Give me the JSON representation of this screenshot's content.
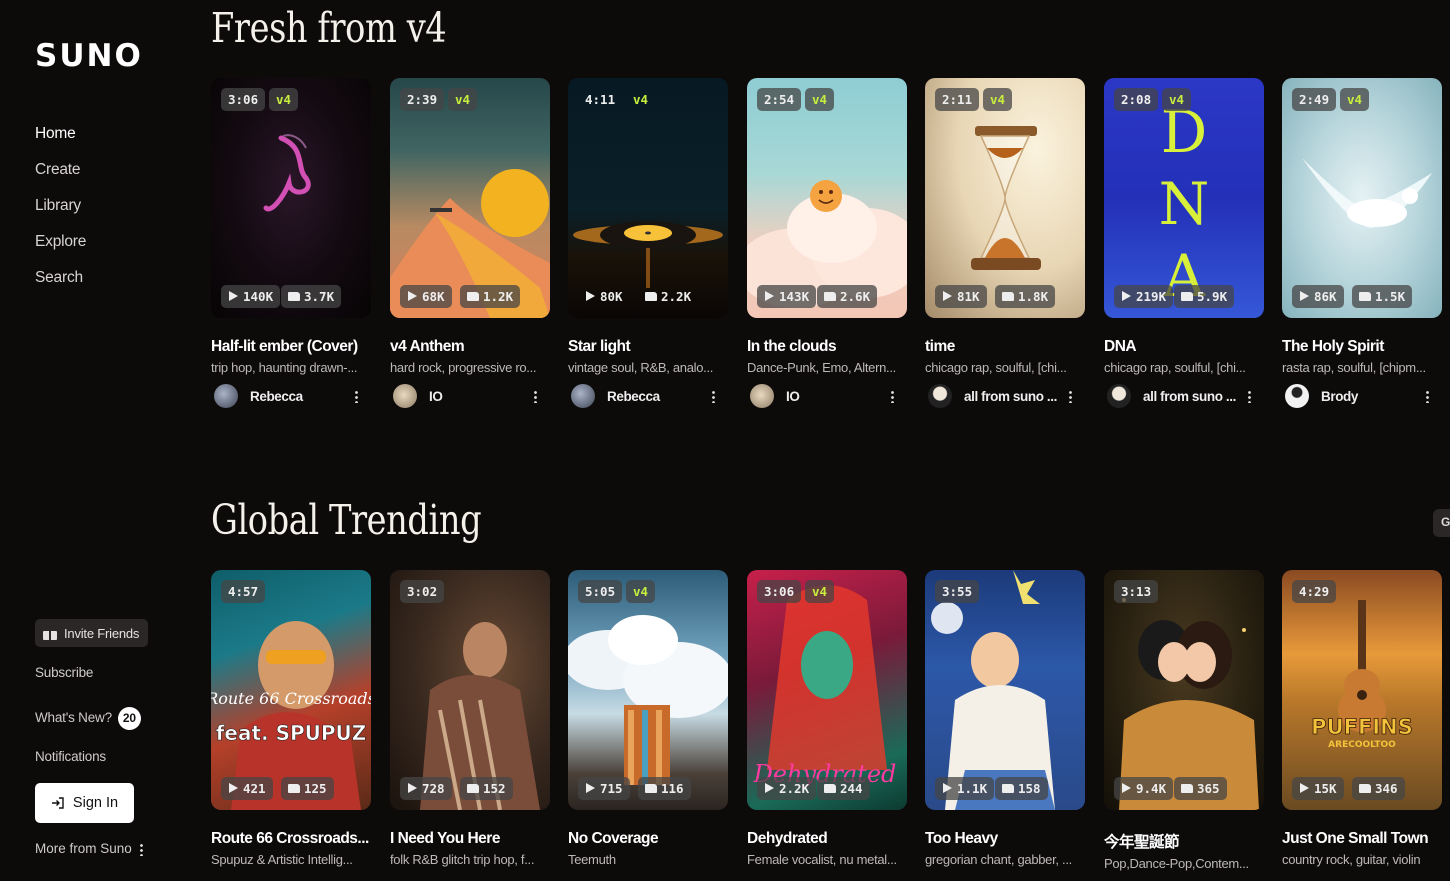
{
  "app": {
    "logo": "SUNO"
  },
  "nav": [
    {
      "label": "Home"
    },
    {
      "label": "Create"
    },
    {
      "label": "Library"
    },
    {
      "label": "Explore"
    },
    {
      "label": "Search"
    }
  ],
  "sidebar": {
    "invite_label": "Invite Friends",
    "subscribe_label": "Subscribe",
    "whats_new_label": "What's New?",
    "whats_new_count": "20",
    "notifications_label": "Notifications",
    "signin_label": "Sign In",
    "more_label": "More from Suno"
  },
  "sections": [
    {
      "title": "Fresh from v4",
      "cards": [
        {
          "duration": "3:06",
          "version": "v4",
          "plays": "140K",
          "likes": "3.7K",
          "title": "Half-lit ember (Cover)",
          "tags": "trip hop, haunting drawn-...",
          "author": "Rebecca"
        },
        {
          "duration": "2:39",
          "version": "v4",
          "plays": "68K",
          "likes": "1.2K",
          "title": "v4 Anthem",
          "tags": "hard rock, progressive ro...",
          "author": "IO"
        },
        {
          "duration": "4:11",
          "version": "v4",
          "plays": "80K",
          "likes": "2.2K",
          "title": "Star light",
          "tags": "vintage soul, R&B, analo...",
          "author": "Rebecca"
        },
        {
          "duration": "2:54",
          "version": "v4",
          "plays": "143K",
          "likes": "2.6K",
          "title": "In the clouds",
          "tags": "Dance-Punk, Emo, Altern...",
          "author": "IO"
        },
        {
          "duration": "2:11",
          "version": "v4",
          "plays": "81K",
          "likes": "1.8K",
          "title": "time",
          "tags": "chicago rap, soulful, [chi...",
          "author": "all from suno ..."
        },
        {
          "duration": "2:08",
          "version": "v4",
          "plays": "219K",
          "likes": "5.9K",
          "title": "DNA",
          "tags": "chicago rap, soulful, [chi...",
          "author": "all from suno ..."
        },
        {
          "duration": "2:49",
          "version": "v4",
          "plays": "86K",
          "likes": "1.5K",
          "title": "The Holy Spirit",
          "tags": "rasta rap, soulful, [chipm...",
          "author": "Brody"
        }
      ]
    },
    {
      "title": "Global Trending",
      "scroll_label": "G",
      "cards": [
        {
          "duration": "4:57",
          "version": "",
          "plays": "421",
          "likes": "125",
          "title": "Route 66 Crossroads...",
          "tags": "Spupuz & Artistic Intellig...",
          "art_text_1": "Route 66 Crossroads",
          "art_text_2": "feat. SPUPUZ"
        },
        {
          "duration": "3:02",
          "version": "",
          "plays": "728",
          "likes": "152",
          "title": "I Need You Here",
          "tags": "folk R&B glitch trip hop, f..."
        },
        {
          "duration": "5:05",
          "version": "v4",
          "plays": "715",
          "likes": "116",
          "title": "No Coverage",
          "tags": "Teemuth"
        },
        {
          "duration": "3:06",
          "version": "v4",
          "plays": "2.2K",
          "likes": "244",
          "title": "Dehydrated",
          "tags": "Female vocalist, nu metal...",
          "art_text_1": "Dehydrated"
        },
        {
          "duration": "3:55",
          "version": "",
          "plays": "1.1K",
          "likes": "158",
          "title": "Too Heavy",
          "tags": "gregorian chant, gabber, ..."
        },
        {
          "duration": "3:13",
          "version": "",
          "plays": "9.4K",
          "likes": "365",
          "title": "今年聖誕節",
          "tags": "Pop,Dance-Pop,Contem..."
        },
        {
          "duration": "4:29",
          "version": "",
          "plays": "15K",
          "likes": "346",
          "title": "Just One Small Town",
          "tags": "country rock, guitar, violin",
          "art_text_1": "PUFFINS",
          "art_text_2": "ARECOOLTOO"
        }
      ]
    }
  ]
}
